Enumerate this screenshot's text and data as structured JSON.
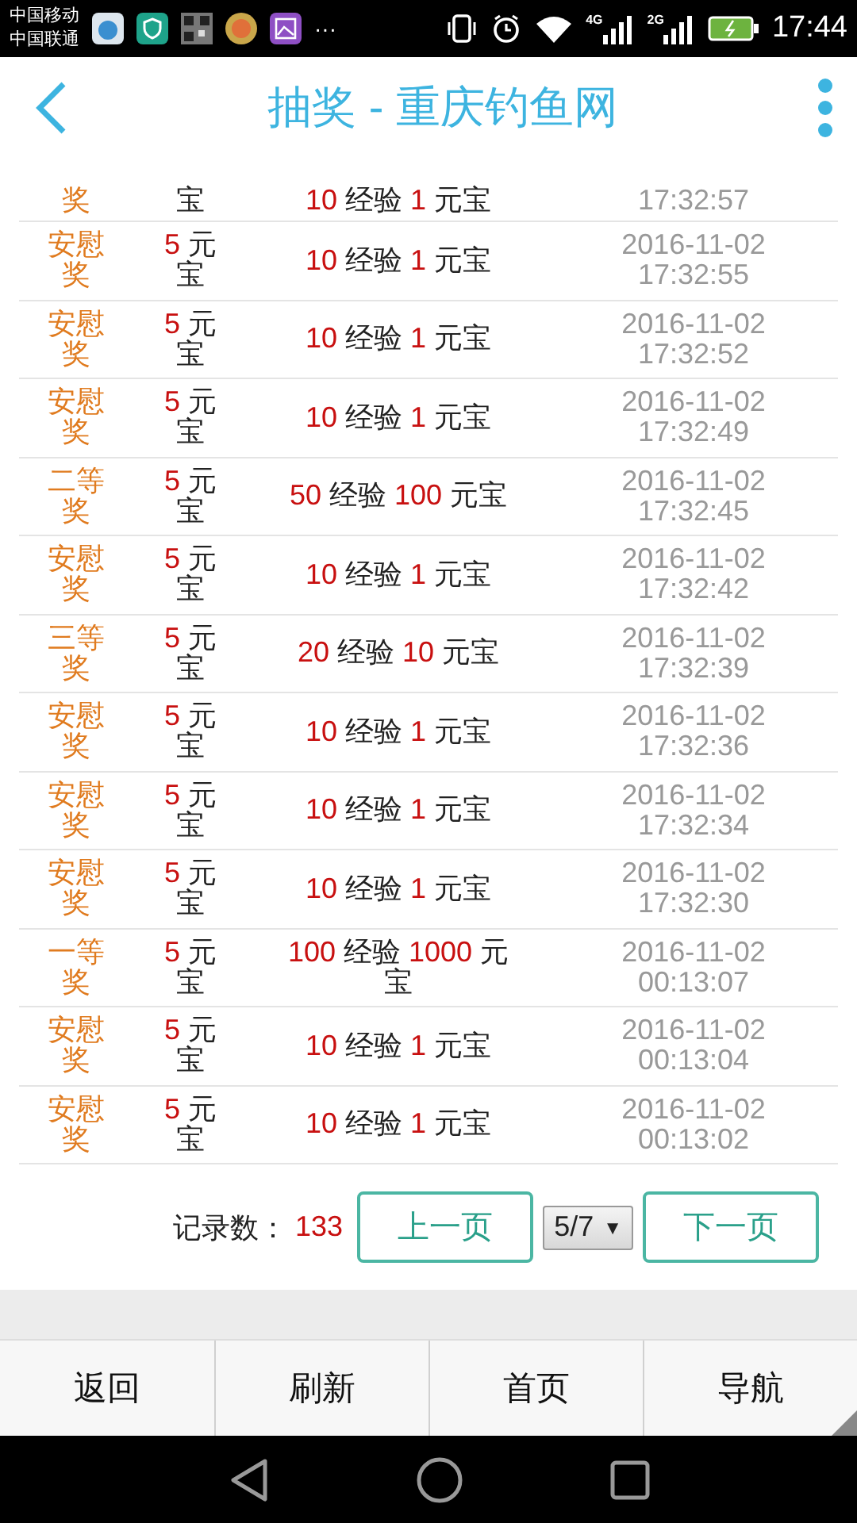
{
  "status_bar": {
    "carriers": [
      "中国移动",
      "中国联通"
    ],
    "network_labels": [
      "4G",
      "2G"
    ],
    "time": "17:44",
    "more": "···"
  },
  "header": {
    "title": "抽奖 - 重庆钓鱼网"
  },
  "records": [
    {
      "kind": "cut",
      "prize": "奖",
      "cost_unit": "宝",
      "exp": "10",
      "exp_label": "经验",
      "coins": "1",
      "coins_label": "元宝",
      "time": "17:32:57"
    },
    {
      "kind": "full",
      "prize": "安慰奖",
      "cost": "5",
      "cost_unit": "元宝",
      "exp": "10",
      "exp_label": "经验",
      "coins": "1",
      "coins_label": "元宝",
      "date": "2016-11-02",
      "time": "17:32:55"
    },
    {
      "kind": "full",
      "prize": "安慰奖",
      "cost": "5",
      "cost_unit": "元宝",
      "exp": "10",
      "exp_label": "经验",
      "coins": "1",
      "coins_label": "元宝",
      "date": "2016-11-02",
      "time": "17:32:52"
    },
    {
      "kind": "full",
      "prize": "安慰奖",
      "cost": "5",
      "cost_unit": "元宝",
      "exp": "10",
      "exp_label": "经验",
      "coins": "1",
      "coins_label": "元宝",
      "date": "2016-11-02",
      "time": "17:32:49"
    },
    {
      "kind": "full",
      "prize": "二等奖",
      "cost": "5",
      "cost_unit": "元宝",
      "exp": "50",
      "exp_label": "经验",
      "coins": "100",
      "coins_label": "元宝",
      "date": "2016-11-02",
      "time": "17:32:45"
    },
    {
      "kind": "full",
      "prize": "安慰奖",
      "cost": "5",
      "cost_unit": "元宝",
      "exp": "10",
      "exp_label": "经验",
      "coins": "1",
      "coins_label": "元宝",
      "date": "2016-11-02",
      "time": "17:32:42"
    },
    {
      "kind": "full",
      "prize": "三等奖",
      "cost": "5",
      "cost_unit": "元宝",
      "exp": "20",
      "exp_label": "经验",
      "coins": "10",
      "coins_label": "元宝",
      "date": "2016-11-02",
      "time": "17:32:39"
    },
    {
      "kind": "full",
      "prize": "安慰奖",
      "cost": "5",
      "cost_unit": "元宝",
      "exp": "10",
      "exp_label": "经验",
      "coins": "1",
      "coins_label": "元宝",
      "date": "2016-11-02",
      "time": "17:32:36"
    },
    {
      "kind": "full",
      "prize": "安慰奖",
      "cost": "5",
      "cost_unit": "元宝",
      "exp": "10",
      "exp_label": "经验",
      "coins": "1",
      "coins_label": "元宝",
      "date": "2016-11-02",
      "time": "17:32:34"
    },
    {
      "kind": "full",
      "prize": "安慰奖",
      "cost": "5",
      "cost_unit": "元宝",
      "exp": "10",
      "exp_label": "经验",
      "coins": "1",
      "coins_label": "元宝",
      "date": "2016-11-02",
      "time": "17:32:30"
    },
    {
      "kind": "full",
      "prize": "一等奖",
      "cost": "5",
      "cost_unit": "元宝",
      "exp": "100",
      "exp_label": "经验",
      "coins": "1000",
      "coins_label": "元宝",
      "date": "2016-11-02",
      "time": "00:13:07"
    },
    {
      "kind": "full",
      "prize": "安慰奖",
      "cost": "5",
      "cost_unit": "元宝",
      "exp": "10",
      "exp_label": "经验",
      "coins": "1",
      "coins_label": "元宝",
      "date": "2016-11-02",
      "time": "00:13:04"
    },
    {
      "kind": "full",
      "prize": "安慰奖",
      "cost": "5",
      "cost_unit": "元宝",
      "exp": "10",
      "exp_label": "经验",
      "coins": "1",
      "coins_label": "元宝",
      "date": "2016-11-02",
      "time": "00:13:02"
    }
  ],
  "pager": {
    "count_label": "记录数：",
    "count": "133",
    "prev": "上一页",
    "page": "5/7",
    "page_caret": "▼",
    "next": "下一页"
  },
  "bottom_nav": [
    "返回",
    "刷新",
    "首页",
    "导航"
  ]
}
